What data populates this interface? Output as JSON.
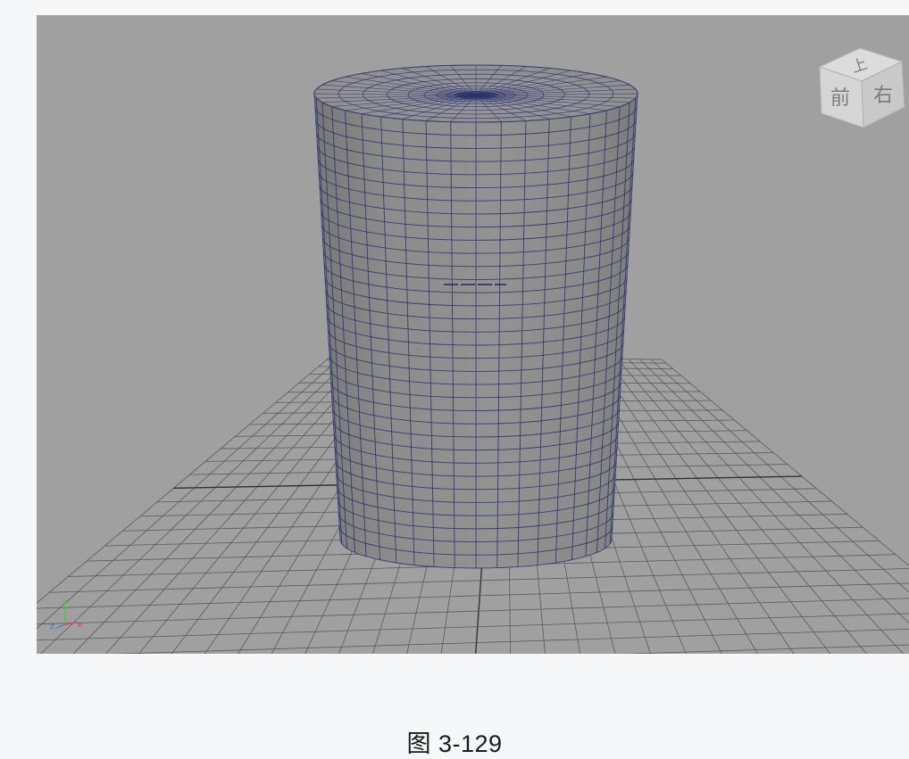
{
  "viewport": {
    "background": "#a0a0a0",
    "object": "polygon cylinder",
    "mesh_color": "#2a2f6a"
  },
  "view_cube": {
    "top_label": "上",
    "front_label": "前",
    "right_label": "右"
  },
  "axis_indicator": {
    "y_label": "y",
    "z_label": "z",
    "x_label": "x",
    "y_color": "#4cc24c",
    "z_color": "#4a6fe0",
    "x_color": "#e04040"
  },
  "caption": "图 3-129"
}
